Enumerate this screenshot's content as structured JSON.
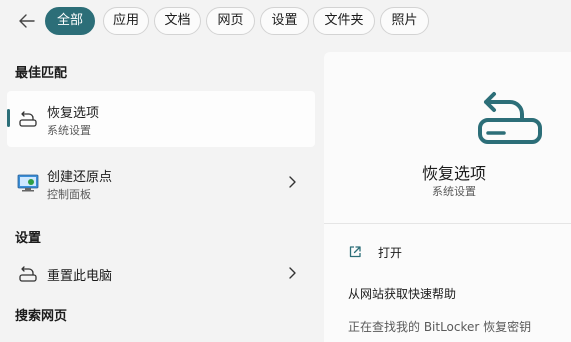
{
  "tabs": [
    {
      "label": "全部",
      "active": true
    },
    {
      "label": "应用"
    },
    {
      "label": "文档"
    },
    {
      "label": "网页"
    },
    {
      "label": "设置"
    },
    {
      "label": "文件夹"
    },
    {
      "label": "照片"
    }
  ],
  "sections": {
    "best_match": "最佳匹配",
    "settings": "设置",
    "web_search": "搜索网页"
  },
  "results": [
    {
      "title": "恢复选项",
      "subtitle": "系统设置",
      "icon": "recovery-icon",
      "selected": true
    },
    {
      "title": "创建还原点",
      "subtitle": "控制面板",
      "icon": "monitor-restore-icon"
    },
    {
      "title": "重置此电脑",
      "subtitle": "",
      "icon": "reset-pc-icon"
    }
  ],
  "detail": {
    "title": "恢复选项",
    "subtitle": "系统设置",
    "open_label": "打开",
    "help_title": "从网站获取快速帮助",
    "help_item_partial": "正在查找我的 BitLocker 恢复密钥"
  },
  "colors": {
    "accent": "#2c6e78",
    "background": "#f3f3f3",
    "panel": "#fbfbfb"
  }
}
